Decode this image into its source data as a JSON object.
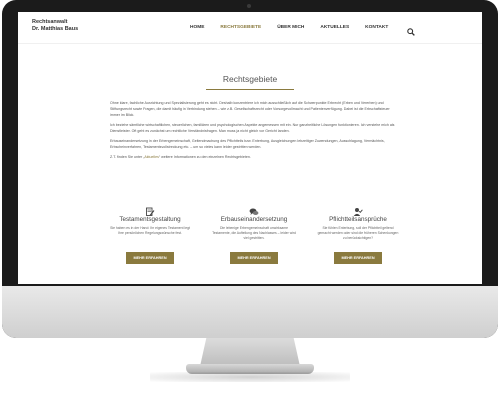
{
  "site": {
    "brand_line1": "Rechtsanwalt",
    "brand_line2": "Dr. Matthias Baus",
    "nav": [
      "HOME",
      "RECHTSGEBIETE",
      "ÜBER MICH",
      "AKTUELLES",
      "KONTAKT"
    ],
    "active_nav": "RECHTSGEBIETE"
  },
  "page": {
    "title": "Rechtsgebiete",
    "paragraphs": [
      "Ohne klare, fachliche Ausrichtung und Spezialisierung geht es nicht. Deshalb konzentriere ich mich ausschließlich auf die Schwerpunkte Erbrecht (Erben und Vererben) und Stiftungsrecht sowie Fragen, die damit häufig in Verbindung stehen – wie z.B. Gesellschaftsrecht oder Vorsorgevollmacht und Patientenverfügung. Dabei ist die Erbschaftsteuer immer im Blick.",
      "Ich beziehe sämtliche wirtschaftlichen, steuerlichen, familiären und psychologischen Aspekte angemessen mit ein. Nur ganzheitliche Lösungen funktionieren. Ich verstehe mich als Dienstleister. Oft geht es zunächst um rechtliche Verständnisfragen. Man muss ja nicht gleich vor Gericht landen.",
      "Erbauseinandersetzung in der Erbengemeinschaft, Geltendmachung des Pflichtteils bzw. Enterbung, Ausgleichungen lebzeitiger Zuwendungen, Ausschlagung, Vermächtnis, Erbscheinverfahren, Testamentsvollstreckung etc. – um so vieles kann leider gestritten werden."
    ],
    "intro_before_link": "Z.T. finden Sie unter „",
    "link_text": "Aktuelles",
    "intro_after_link": "“ weitere Informationen zu den einzelnen Rechtsgebieten."
  },
  "cards": [
    {
      "icon": "document-pen-icon",
      "title": "Testamentsgestaltung",
      "text": "Sie haben es in der Hand: Ihr eigenes Testament legt Ihre persönlichen Regelungswünsche fest.",
      "button": "MEHR ERFAHREN"
    },
    {
      "icon": "speech-bubbles-icon",
      "title": "Erbauseinandersetzung",
      "text": "Die lebenige Erbengemeinschaft unwirksame Testamente, die Aufteilung des Nachlasses – leider wird viel gestritten.",
      "button": "MEHR ERFAHREN"
    },
    {
      "icon": "user-check-icon",
      "title": "Pflichtteilsansprüche",
      "text": "Sie fühlen Enterbung, soll der Pflichtteil geltend gemacht werden oder sind die früheren Schenkungen zu berücksichtigen?",
      "button": "MEHR ERFAHREN"
    }
  ],
  "colors": {
    "accent": "#8a7a3e",
    "bezel": "#1b1b1b",
    "stand": "#cfcfcf"
  }
}
